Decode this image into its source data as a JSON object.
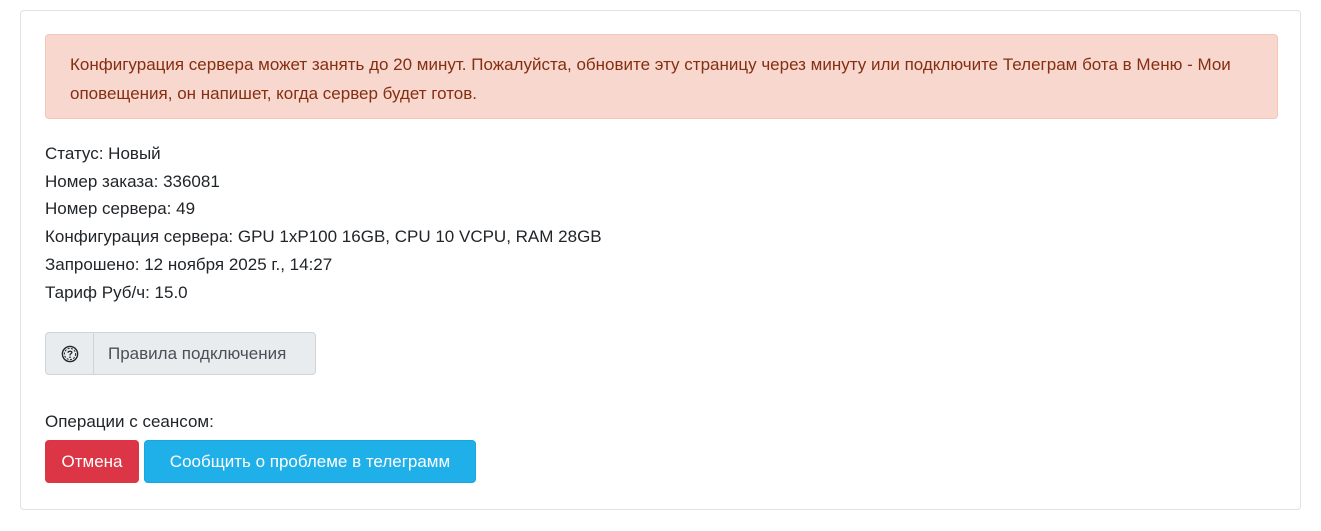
{
  "alert": {
    "text": "Конфигурация сервера может занять до 20 минут. Пожалуйста, обновите эту страницу через минуту или подключите Телеграм бота в Меню - Мои оповещения, он напишет, когда сервер будет готов."
  },
  "info": {
    "status": "Статус: Новый",
    "order_number": "Номер заказа: 336081",
    "server_number": "Номер сервера: 49",
    "configuration": "Конфигурация сервера: GPU 1xP100 16GB, CPU 10 VCPU, RAM 28GB",
    "requested": "Запрошено: 12 ноября 2025 г., 14:27",
    "tariff": "Тариф Руб/ч: 15.0"
  },
  "rules": {
    "icon": "question-circle-icon",
    "label": "Правила подключения"
  },
  "operations": {
    "label": "Операции с сеансом:",
    "cancel_label": "Отмена",
    "report_label": "Сообщить о проблеме в телеграмм"
  },
  "colors": {
    "alert_bg": "#f8d7cf",
    "alert_text": "#842f0f",
    "cancel_bg": "#dc3545",
    "report_bg": "#1fb0ea"
  }
}
